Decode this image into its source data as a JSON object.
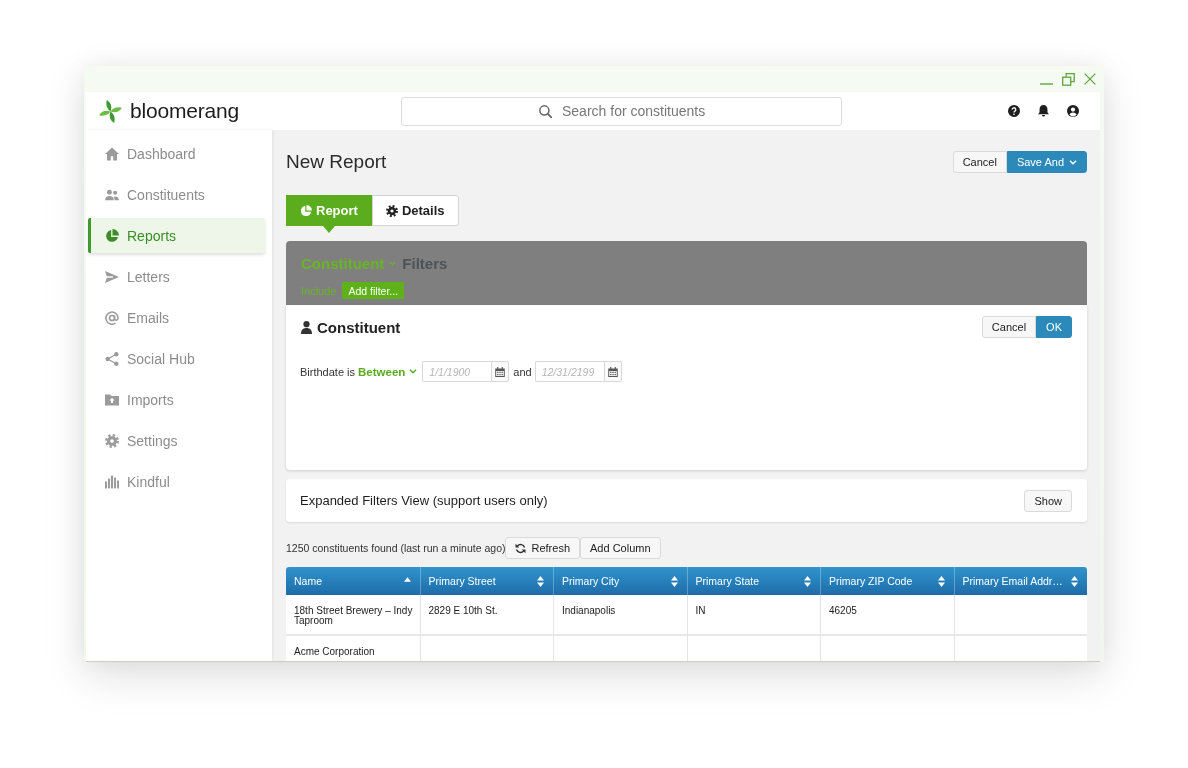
{
  "header": {
    "logo": "bloomerang",
    "search": {
      "placeholder": "Search for constituents"
    }
  },
  "sidebar": {
    "items": [
      {
        "label": "Dashboard",
        "selected": false
      },
      {
        "label": "Constituents",
        "selected": false
      },
      {
        "label": "Reports",
        "selected": true
      },
      {
        "label": "Letters",
        "selected": false
      },
      {
        "label": "Emails",
        "selected": false
      },
      {
        "label": "Social Hub",
        "selected": false
      },
      {
        "label": "Imports",
        "selected": false
      },
      {
        "label": "Settings",
        "selected": false
      },
      {
        "label": "Kindful",
        "selected": false
      }
    ]
  },
  "page": {
    "title": "New Report",
    "actions": [
      {
        "label": "Cancel",
        "kind": "plain"
      },
      {
        "label": "Save And",
        "kind": "menu"
      }
    ]
  },
  "tabs": [
    {
      "label": "Report",
      "selected": true
    },
    {
      "label": "Details",
      "selected": false
    }
  ],
  "filter_bar": {
    "entity": "Constituent",
    "title": "Filters",
    "include": "Include",
    "add_button": "Add filter..."
  },
  "filter_editor": {
    "title": "Constituent",
    "actions": [
      {
        "label": "Cancel",
        "kind": "plain"
      },
      {
        "label": "OK",
        "kind": "primary"
      }
    ],
    "condition": {
      "field": "Birthdate is",
      "operator": "Between",
      "from": {
        "placeholder": "1/1/1900"
      },
      "joiner": "and",
      "to": {
        "placeholder": "12/31/2199"
      }
    }
  },
  "expanded_filters": {
    "title": "Expanded Filters View (support users only)",
    "button": "Show"
  },
  "results": {
    "summary": "1250 constituents found (last run a minute ago)",
    "refresh": "Refresh",
    "add_column": "Add Column"
  },
  "table": {
    "columns": [
      {
        "label": "Name",
        "sorted": true
      },
      {
        "label": "Primary Street",
        "sorted": false
      },
      {
        "label": "Primary City",
        "sorted": false
      },
      {
        "label": "Primary State",
        "sorted": false
      },
      {
        "label": "Primary ZIP Code",
        "sorted": false
      },
      {
        "label": "Primary Email Addr…",
        "sorted": false
      }
    ],
    "rows": [
      {
        "cells": [
          "18th Street Brewery – Indy Taproom",
          "2829 E 10th St.",
          "Indianapolis",
          "IN",
          "46205",
          null
        ]
      },
      {
        "cells": [
          "Acme Corporation",
          null,
          null,
          null,
          null,
          null
        ]
      }
    ]
  }
}
